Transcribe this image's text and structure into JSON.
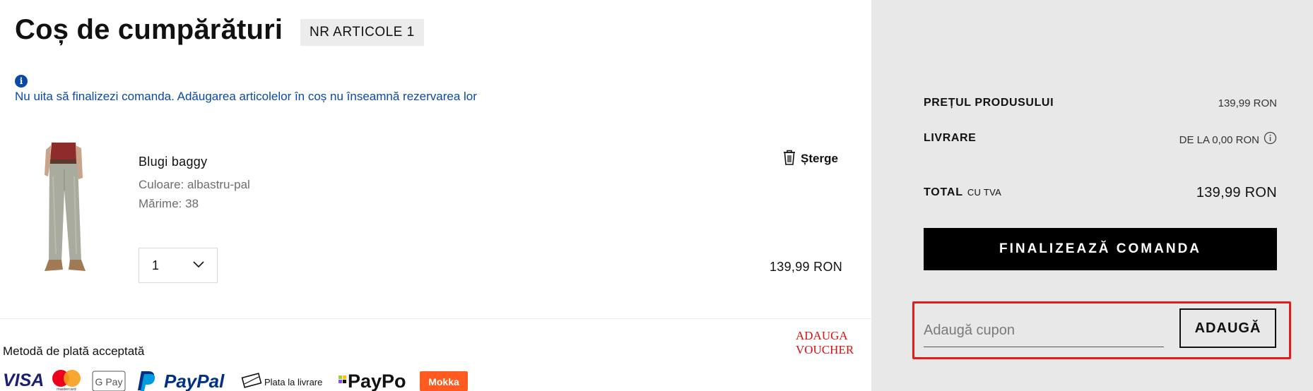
{
  "header": {
    "title": "Coș de cumpărături",
    "item_count_badge": "NR ARTICOLE 1"
  },
  "notice": {
    "icon": "info-icon",
    "icon_glyph": "i",
    "text": "Nu uita să finalizezi comanda. Adăugarea articolelor în coș nu înseamnă rezervarea lor"
  },
  "cart": {
    "items": [
      {
        "name": "Blugi baggy",
        "color_text": "Culoare: albastru-pal",
        "size_text": "Mărime: 38",
        "quantity": "1",
        "price": "139,99 RON",
        "delete_label": "Șterge",
        "image_icon": "product-jeans-image"
      }
    ]
  },
  "payment": {
    "title": "Metodă de plată acceptată",
    "methods": [
      {
        "name": "VISA"
      },
      {
        "name": "mastercard"
      },
      {
        "name": "G Pay"
      },
      {
        "name": "PayPal"
      },
      {
        "name": "Plata la livrare"
      },
      {
        "name": "PayPo"
      },
      {
        "name": "Mokka"
      }
    ]
  },
  "summary": {
    "product_price_label": "PREȚUL PRODUSULUI",
    "product_price_value": "139,99 RON",
    "delivery_label": "LIVRARE",
    "delivery_value": "DE LA 0,00 RON",
    "total_label": "TOTAL",
    "total_vat_label": "CU TVA",
    "total_value": "139,99 RON",
    "checkout_label": "FINALIZEAZĂ COMANDA"
  },
  "voucher": {
    "annotation": "ADAUGA VOUCHER",
    "placeholder": "Adaugă cupon",
    "add_label": "ADAUGĂ"
  },
  "colors": {
    "accent_blue": "#0a49a8",
    "summary_bg": "#e8e8e8",
    "annotation_red": "#e31b1b",
    "checkout_bg": "#000000",
    "mokka_orange": "#ff5a1f",
    "paypal_dark": "#003087",
    "paypal_light": "#009cde"
  }
}
